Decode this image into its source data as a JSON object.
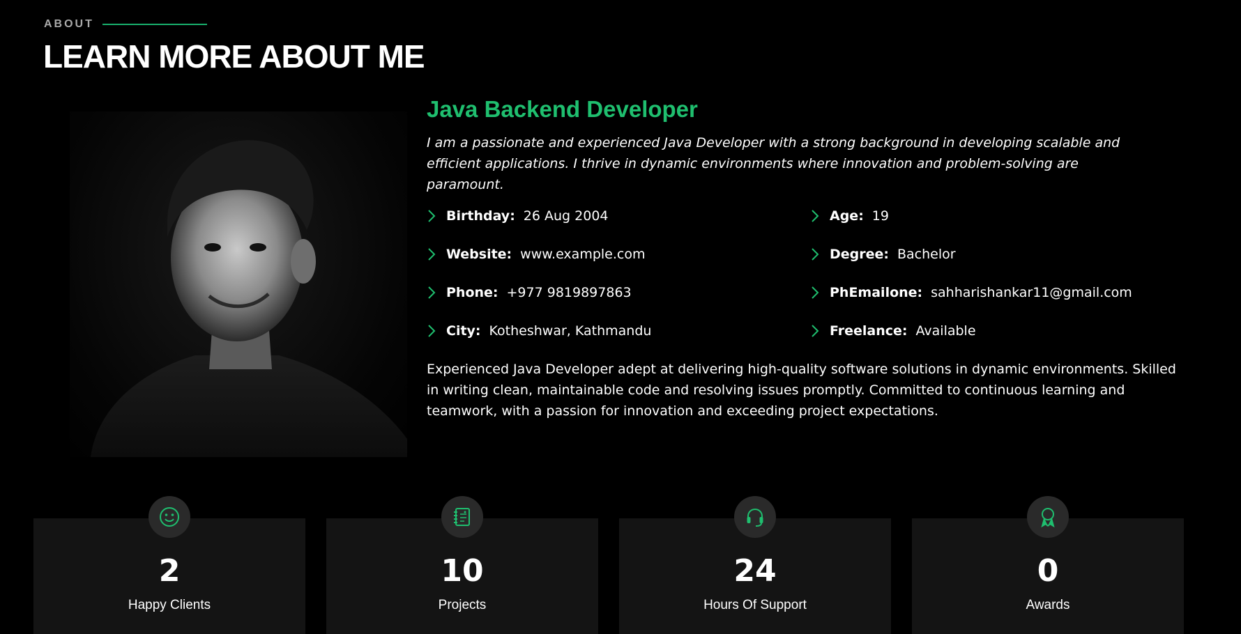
{
  "section": {
    "tag": "ABOUT",
    "title": "LEARN MORE ABOUT ME"
  },
  "profile": {
    "role": "Java Backend Developer",
    "intro": "I am a passionate and experienced Java Developer with a strong background in developing scalable and efficient applications. I thrive in dynamic environments where innovation and problem-solving are paramount.",
    "facts": [
      {
        "key": "Birthday:",
        "value": "26 Aug 2004"
      },
      {
        "key": "Age:",
        "value": "19"
      },
      {
        "key": "Website:",
        "value": "www.example.com"
      },
      {
        "key": "Degree:",
        "value": "Bachelor"
      },
      {
        "key": "Phone:",
        "value": "+977 9819897863"
      },
      {
        "key": "PhEmailone:",
        "value": "sahharishankar11@gmail.com"
      },
      {
        "key": "City:",
        "value": "Kotheshwar, Kathmandu"
      },
      {
        "key": "Freelance:",
        "value": "Available"
      }
    ],
    "description": "Experienced Java Developer adept at delivering high-quality software solutions in dynamic environments. Skilled in writing clean, maintainable code and resolving issues promptly. Committed to continuous learning and teamwork, with a passion for innovation and exceeding project expectations."
  },
  "stats": [
    {
      "number": "2",
      "label": "Happy Clients",
      "icon": "smiley-icon"
    },
    {
      "number": "10",
      "label": "Projects",
      "icon": "journal-icon"
    },
    {
      "number": "24",
      "label": "Hours Of Support",
      "icon": "headset-icon"
    },
    {
      "number": "0",
      "label": "Awards",
      "icon": "award-icon"
    }
  ],
  "colors": {
    "accent": "#1fbf6f",
    "background": "#000000",
    "card": "#141414"
  }
}
